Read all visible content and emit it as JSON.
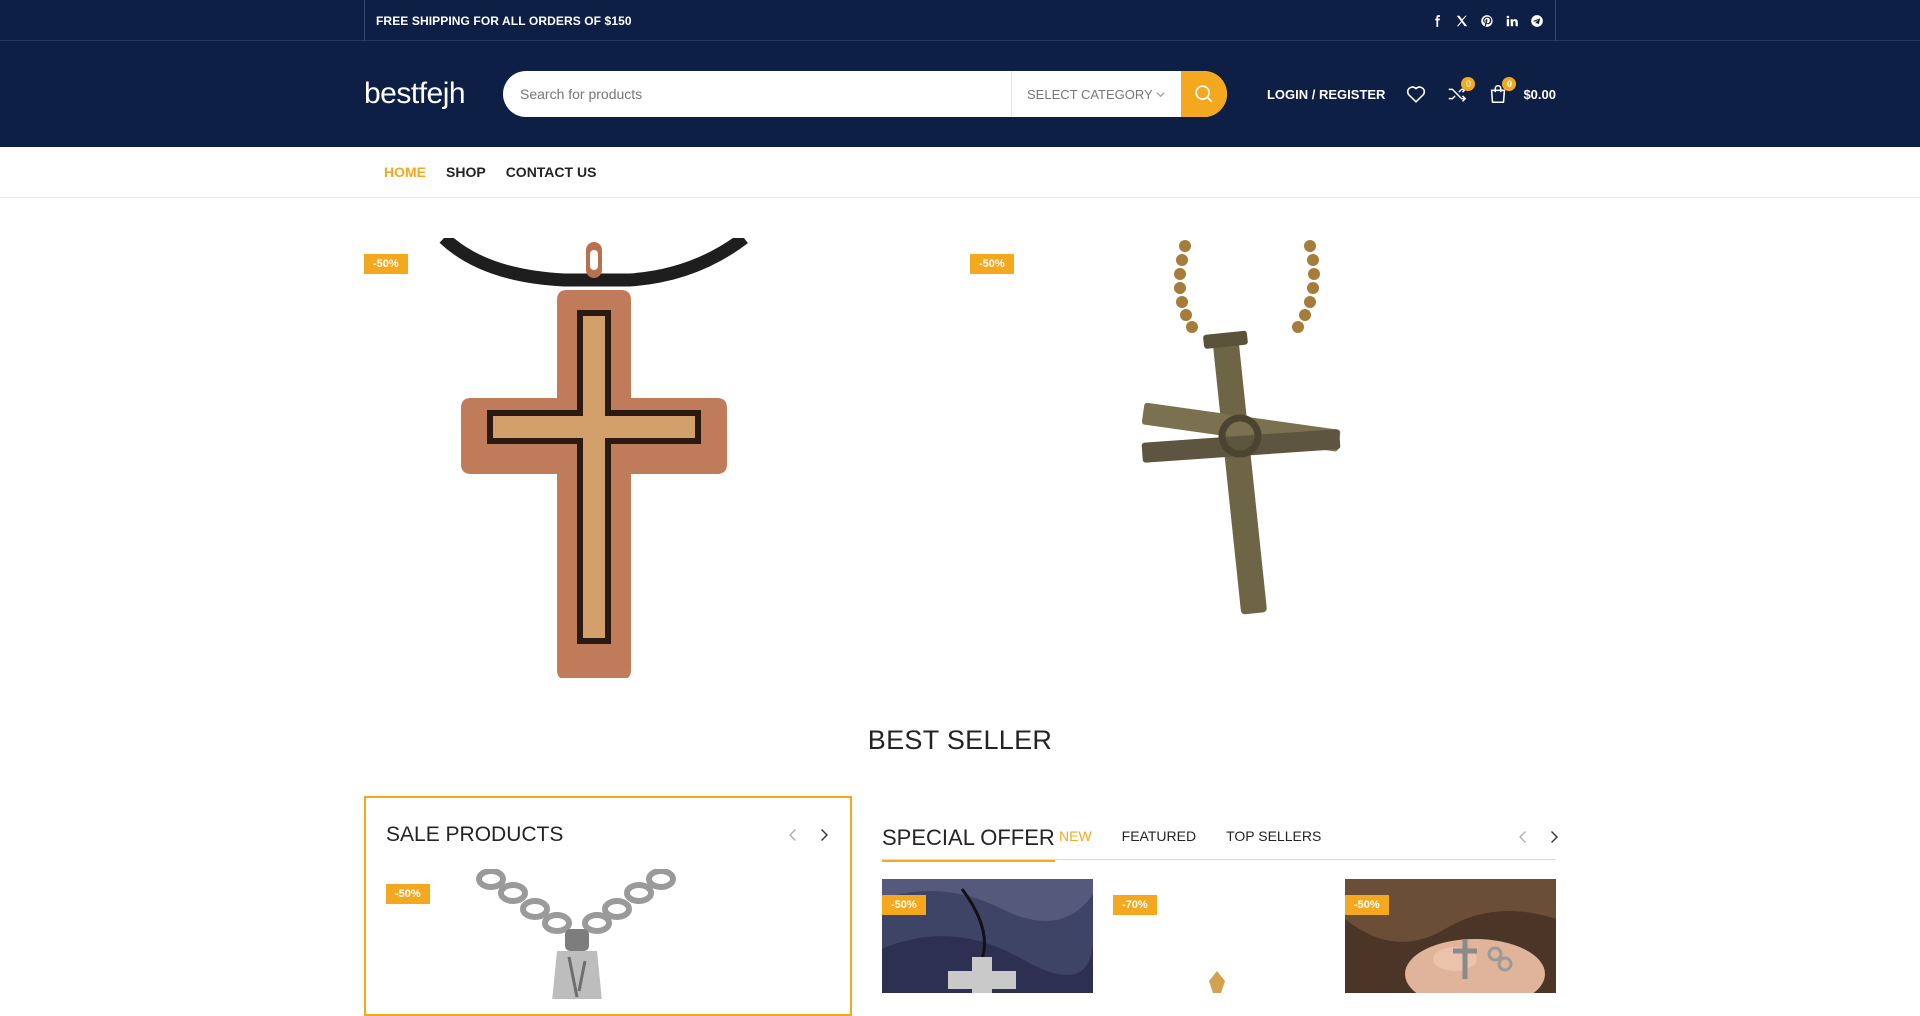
{
  "topbar": {
    "promo": "FREE SHIPPING FOR ALL ORDERS OF $150",
    "social": [
      "facebook-icon",
      "x-icon",
      "pinterest-icon",
      "linkedin-icon",
      "telegram-icon"
    ]
  },
  "header": {
    "logo": "bestfejh",
    "search_placeholder": "Search for products",
    "category_label": "SELECT CATEGORY",
    "login_label": "LOGIN / REGISTER",
    "compare_count": "0",
    "cart_count": "0",
    "cart_total": "$0.00"
  },
  "nav": {
    "items": [
      "HOME",
      "SHOP",
      "CONTACT US"
    ],
    "active": "HOME"
  },
  "hero": {
    "badges": [
      "-50%",
      "-50%"
    ]
  },
  "best_seller_title": "BEST SELLER",
  "sale_products": {
    "title": "SALE PRODUCTS",
    "badge": "-50%"
  },
  "special_offer": {
    "title": "SPECIAL OFFER",
    "tabs": [
      "NEW",
      "FEATURED",
      "TOP SELLERS"
    ],
    "active_tab": "NEW",
    "badges": [
      "-50%",
      "-70%",
      "-50%"
    ]
  },
  "colors": {
    "navy": "#0d1f45",
    "accent": "#f4a81f"
  }
}
